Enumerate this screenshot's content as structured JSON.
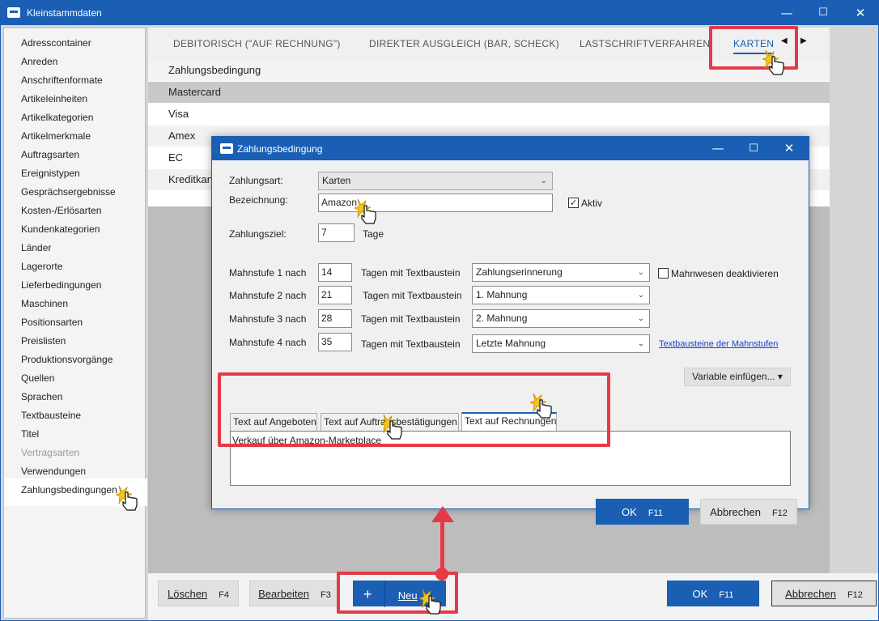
{
  "window": {
    "title": "Kleinstammdaten",
    "minimize_glyph": "—",
    "maximize_glyph": "☐",
    "close_glyph": "✕"
  },
  "sidebar": {
    "items": [
      {
        "label": "Adresscontainer"
      },
      {
        "label": "Anreden"
      },
      {
        "label": "Anschriftenformate"
      },
      {
        "label": "Artikeleinheiten"
      },
      {
        "label": "Artikelkategorien"
      },
      {
        "label": "Artikelmerkmale"
      },
      {
        "label": "Auftragsarten"
      },
      {
        "label": "Ereignistypen"
      },
      {
        "label": "Gesprächsergebnisse"
      },
      {
        "label": "Kosten-/Erlösarten"
      },
      {
        "label": "Kundenkategorien"
      },
      {
        "label": "Länder"
      },
      {
        "label": "Lagerorte"
      },
      {
        "label": "Lieferbedingungen"
      },
      {
        "label": "Maschinen"
      },
      {
        "label": "Positionsarten"
      },
      {
        "label": "Preislisten"
      },
      {
        "label": "Produktionsvorgänge"
      },
      {
        "label": "Quellen"
      },
      {
        "label": "Sprachen"
      },
      {
        "label": "Textbausteine"
      },
      {
        "label": "Titel"
      },
      {
        "label": "Vertragsarten",
        "state": "disabled"
      },
      {
        "label": "Verwendungen"
      },
      {
        "label": "Zahlungsbedingungen",
        "state": "selected"
      }
    ]
  },
  "main": {
    "tabs": [
      {
        "label": "DEBITORISCH (\"AUF RECHNUNG\")"
      },
      {
        "label": "DIREKTER AUSGLEICH (BAR, SCHECK)"
      },
      {
        "label": "LASTSCHRIFTVERFAHREN"
      },
      {
        "label": "KARTEN",
        "state": "active"
      }
    ],
    "tab_prev_glyph": "◀",
    "tab_next_glyph": "▶",
    "list_header": "Zahlungsbedingung",
    "rows": [
      "Mastercard",
      "Visa",
      "Amex",
      "EC",
      "Kreditkarte"
    ]
  },
  "bottom": {
    "delete_label": "Löschen",
    "delete_key": "F4",
    "edit_label": "Bearbeiten",
    "edit_key": "F3",
    "new_plus": "+",
    "new_label": "Neu",
    "ok_label": "OK",
    "ok_key": "F11",
    "cancel_label": "Abbrechen",
    "cancel_key": "F12"
  },
  "dialog": {
    "title": "Zahlungsbedingung",
    "minimize_glyph": "—",
    "maximize_glyph": "☐",
    "close_glyph": "✕",
    "zahlungsart_label": "Zahlungsart:",
    "zahlungsart_value": "Karten",
    "bezeichnung_label": "Bezeichnung:",
    "bezeichnung_value": "Amazon",
    "aktiv_label": "Aktiv",
    "aktiv_checked": true,
    "zahlungsziel_label": "Zahlungsziel:",
    "zahlungsziel_value": "7",
    "tage_label": "Tage",
    "check_glyph": "✓",
    "chevron_glyph": "⌄",
    "mahnstufen": [
      {
        "label": "Mahnstufe 1 nach",
        "days": "14",
        "tagen_label": "Tagen mit Textbaustein",
        "textbaustein": "Zahlungserinnerung"
      },
      {
        "label": "Mahnstufe 2 nach",
        "days": "21",
        "tagen_label": "Tagen mit Textbaustein",
        "textbaustein": "1. Mahnung"
      },
      {
        "label": "Mahnstufe 3 nach",
        "days": "28",
        "tagen_label": "Tagen mit Textbaustein",
        "textbaustein": "2. Mahnung"
      },
      {
        "label": "Mahnstufe 4 nach",
        "days": "35",
        "tagen_label": "Tagen mit Textbaustein",
        "textbaustein": "Letzte Mahnung"
      }
    ],
    "mahnwesen_label": "Mahnwesen deaktivieren",
    "mahnwesen_checked": false,
    "textbausteine_link": "Textbausteine der Mahnstufen",
    "variable_button": "Variable einfügen... ▾",
    "inner_tabs": [
      {
        "label": "Text auf Angeboten"
      },
      {
        "label": "Text auf Auftragsbestätigungen"
      },
      {
        "label": "Text auf Rechnungen",
        "state": "active"
      }
    ],
    "text_value": "Verkauf über Amazon-Marketplace",
    "ok_label": "OK",
    "ok_key": "F11",
    "cancel_label": "Abbrechen",
    "cancel_key": "F12"
  },
  "colors": {
    "accent": "#1a5fb4",
    "highlight": "#e63946",
    "cursor_flash": "#f5c518"
  }
}
